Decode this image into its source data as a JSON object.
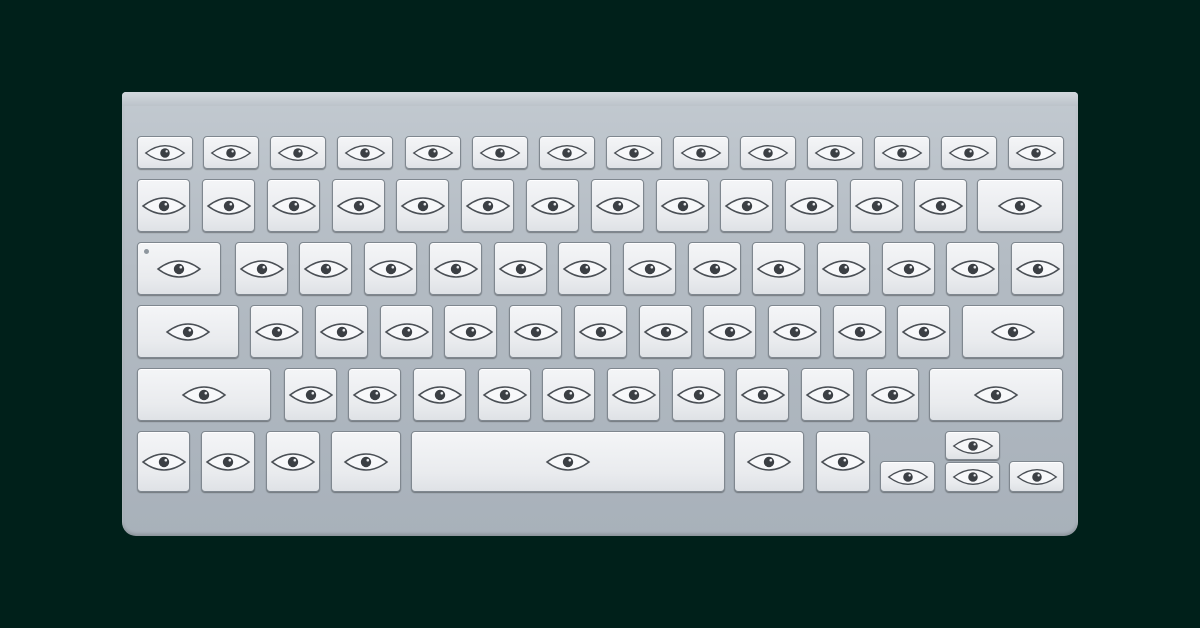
{
  "colors": {
    "background": "#00201a",
    "keyboard_body": "#b3bbc3",
    "key_face": "#eceef1",
    "key_border": "#7f878f",
    "eye_stroke": "#4a4f55",
    "pupil": "#3b3f44"
  },
  "icons": {
    "key_glyph": "eye-icon",
    "caps_indicator": "caps-lock-light"
  },
  "keyboard": {
    "rows": 6,
    "total_keys": 78
  }
}
